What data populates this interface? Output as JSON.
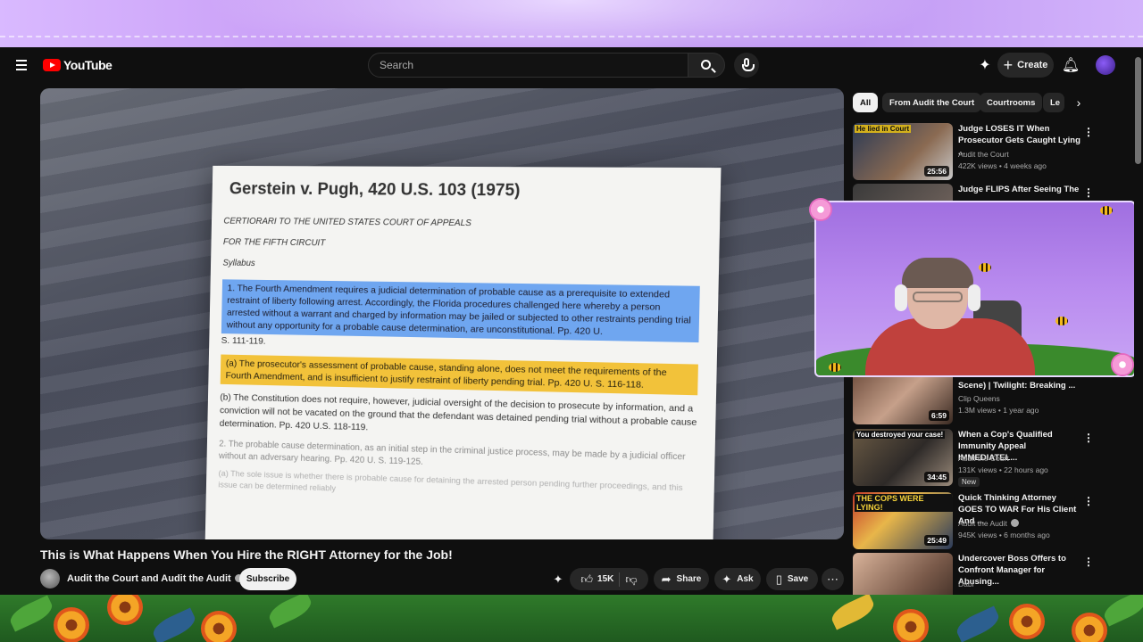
{
  "header": {
    "logo_text": "YouTube",
    "search_placeholder": "Search",
    "create_label": "Create",
    "avatar_icon": "channel-avatar"
  },
  "video": {
    "title": "This is What Happens When You Hire the RIGHT Attorney for the Job!",
    "channel": "Audit the Court and Audit the Audit",
    "subscribe_label": "Subscribe",
    "likes": "15K",
    "share_label": "Share",
    "ask_label": "Ask",
    "save_label": "Save"
  },
  "document": {
    "title": "Gerstein v. Pugh, 420 U.S. 103 (1975)",
    "line1": "CERTIORARI TO THE UNITED STATES COURT OF APPEALS",
    "line2": "FOR THE FIFTH CIRCUIT",
    "line3": "Syllabus",
    "blue_highlight": "1. The Fourth Amendment requires a judicial determination of probable cause as a prerequisite to extended restraint of liberty following arrest. Accordingly, the Florida procedures challenged here whereby a person arrested without a warrant and charged by information may be jailed or subjected to other restraints pending trial without any opportunity for a probable cause determination, are unconstitutional. Pp. 420 U.",
    "blue_tail": "S. 111-119.",
    "yellow_highlight": "(a) The prosecutor's assessment of probable cause, standing alone, does not meet the requirements of the Fourth Amendment, and is insufficient to justify restraint of liberty pending trial. Pp. 420 U. S. 116-118.",
    "para_b": "(b) The Constitution does not require, however, judicial oversight of the decision to prosecute by information, and a conviction will not be vacated on the ground that the defendant was detained pending trial without a probable cause determination. Pp. 420 U.S. 118-119.",
    "para_2": "2. The probable cause determination, as an initial step in the criminal justice process, may be made by a judicial officer without an adversary hearing. Pp. 420 U. S. 119-125.",
    "para_a2": "(a) The sole issue is whether there is probable cause for detaining the arrested person pending further proceedings, and this issue can be determined reliably"
  },
  "chips": [
    "All",
    "From Audit the Court",
    "Courtrooms",
    "Le"
  ],
  "recommendations": [
    {
      "title": "Judge LOSES IT When Prosecutor Gets Caught Lying ...",
      "channel": "Audit the Court",
      "meta": "422K views • 4 weeks ago",
      "duration": "25:56",
      "caption": "He lied in Court"
    },
    {
      "title": "Judge FLIPS After Seeing The",
      "channel": "",
      "meta": "",
      "duration": "",
      "caption": ""
    },
    {
      "title": "Scene) | Twilight: Breaking ...",
      "channel": "Clip Queens",
      "meta": "1.3M views • 1 year ago",
      "duration": "6:59",
      "caption": ""
    },
    {
      "title": "When a Cop's Qualified Immunity Appeal IMMEDIATEL...",
      "channel": "Audit the Court",
      "meta": "131K views • 22 hours ago",
      "duration": "34:45",
      "caption": "You destroyed your case!",
      "badge": "New"
    },
    {
      "title": "Quick Thinking Attorney GOES TO WAR For His Client And ...",
      "channel": "Audit the Audit",
      "meta": "945K views • 6 months ago",
      "duration": "25:49",
      "caption": "THE COPS WERE LYING!"
    },
    {
      "title": "Undercover Boss Offers to Confront Manager for Abusing...",
      "channel": "Dabl",
      "meta": "",
      "duration": "",
      "caption": ""
    }
  ],
  "colors": {
    "brand_red": "#ff0000",
    "highlight_blue": "#6fa6f0",
    "highlight_yellow": "#f2c23a",
    "overlay_purple": "#c79bf5"
  }
}
